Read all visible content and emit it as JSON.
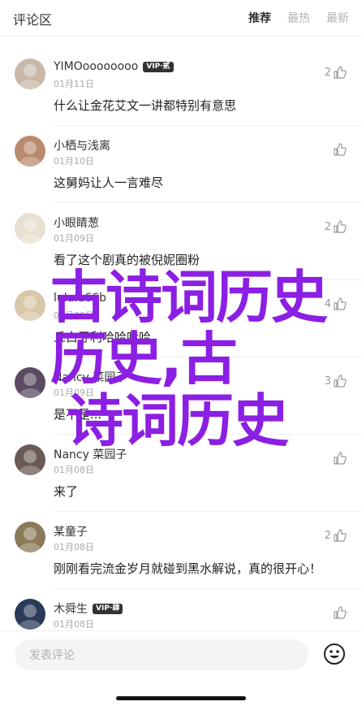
{
  "header": {
    "title": "评论区",
    "tabs": [
      {
        "label": "推荐",
        "active": true
      },
      {
        "label": "最热",
        "active": false
      },
      {
        "label": "最新",
        "active": false
      }
    ]
  },
  "comments": [
    {
      "name": "YIMOoooooooo",
      "vip": "VIP·贰",
      "date": "01月11日",
      "text": "什么让金花艾文一讲都特别有意思",
      "likes": "2",
      "avatar_color": "#c9b8a8"
    },
    {
      "name": "小栖与浅离",
      "vip": "",
      "date": "01月10日",
      "text": "这舅妈让人一言难尽",
      "likes": "",
      "avatar_color": "#b98b6e"
    },
    {
      "name": "小眼睛葱",
      "vip": "",
      "date": "01月09日",
      "text": "看了这个剧真的被倪妮圈粉",
      "likes": "2",
      "avatar_color": "#e8e0d0"
    },
    {
      "name": "lululu66b",
      "vip": "",
      "date": "01月09日",
      "text": "丘白牙利哈哈哈哈",
      "likes": "4",
      "avatar_color": "#d8c7a8"
    },
    {
      "name": "Nancy 菜园子",
      "vip": "",
      "date": "01月09日",
      "text": "是不是...",
      "likes": "3",
      "avatar_color": "#5a4a62"
    },
    {
      "name": "Nancy 菜园子",
      "vip": "",
      "date": "01月08日",
      "text": "来了",
      "likes": "",
      "avatar_color": "#6a5a55"
    },
    {
      "name": "某童子",
      "vip": "",
      "date": "01月08日",
      "text": "刚刚看完流金岁月就碰到黑水解说，真的很开心！",
      "likes": "2",
      "avatar_color": "#8a7a58"
    },
    {
      "name": "木舜生",
      "vip": "VIP·肆",
      "date": "01月08日",
      "text": "",
      "likes": "",
      "avatar_color": "#2a3b5a"
    }
  ],
  "overlay": {
    "line1": "古诗词历史",
    "line2": "历史,古",
    "line3": "诗词历史",
    "color": "#8b1fe3"
  },
  "bottom": {
    "placeholder": "发表评论"
  },
  "icons": {
    "like": "thumbs-up-icon",
    "emoji": "smiley-icon"
  }
}
